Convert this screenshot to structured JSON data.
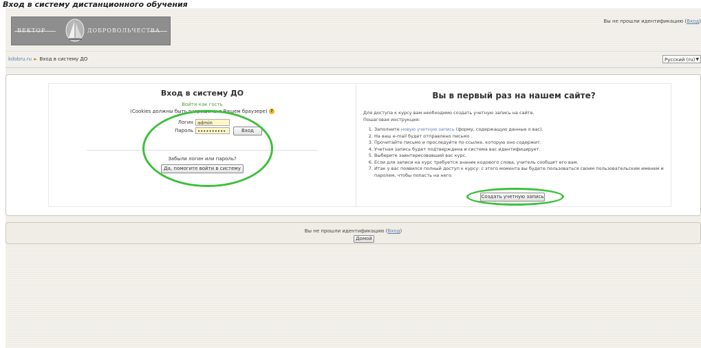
{
  "caption": "Вход в систему дистанционного обучения",
  "logo": {
    "word1": "ВЕКТОР",
    "word2": "ДОБРОВОЛЬЧЕСТВА"
  },
  "header": {
    "login_status": "Вы не прошли идентификацию (",
    "login_link": "Вход",
    "login_close": ")"
  },
  "breadcrumb": {
    "home": "kdobru.ru",
    "separator": "►",
    "current": "Вход в систему ДО"
  },
  "language": {
    "selected": "Русский (ru)"
  },
  "login": {
    "title": "Вход в систему ДО",
    "guest_link": "Войти как гость",
    "cookies_note": "(Cookies должны быть разрешены в Вашем браузере)",
    "username_label": "Логин",
    "username_value": "admin",
    "password_label": "Пароль",
    "password_value": "••••••••••",
    "login_button": "Вход",
    "forgot_text": "Забыли логин или пароль?",
    "forgot_button": "Да, помогите войти в систему"
  },
  "signup": {
    "title": "Вы в первый раз на нашем сайте?",
    "intro1": "Для доступа к курсу вам необходимо создать учетную запись на сайте.",
    "intro2": "Пошаговая инструкция:",
    "step1_pre": "Заполните ",
    "step1_link": "новую учетную запись",
    "step1_post": " (форму, содержащую данные о вас).",
    "step2": "На ваш e-mail будет отправлено письмо .",
    "step3": "Прочитайте письмо и проследуйте по ссылке, которую оно содержит.",
    "step4": "Учетная запись будет подтверждена и система вас идентифицирует.",
    "step5": "Выберите заинтересовавший вас курс.",
    "step6": "Если для записи на курс требуется знание кодового слова, учитель сообщит его вам.",
    "step7": "Итак у вас появился полный доступ к курсу: с этого момента вы будете пользоваться своим пользовательским именем и паролем, чтобы попасть на него.",
    "create_button": "Создать учетную запись"
  },
  "footer": {
    "status": "Вы не прошли идентификацию (",
    "link": "Вход",
    "close": ")",
    "home_button": "Домой"
  },
  "colors": {
    "accent_link": "#5b7fb0",
    "highlight": "#3bbf3b",
    "input_bg": "#fff8c4"
  }
}
